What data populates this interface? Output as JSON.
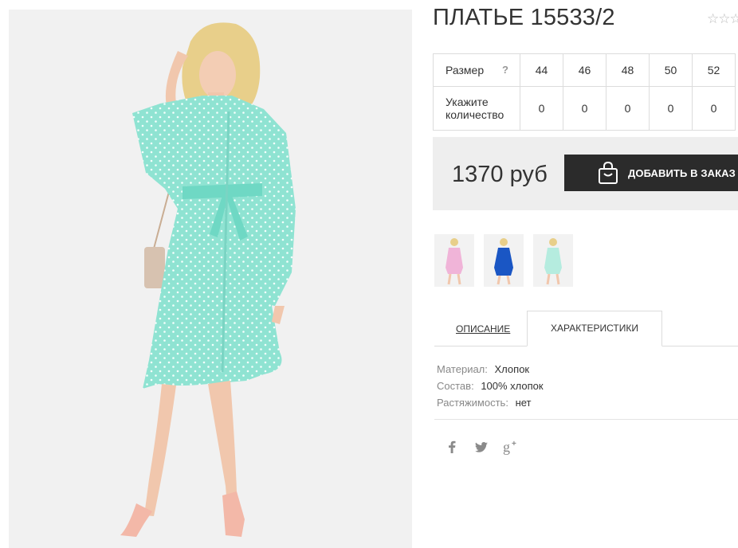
{
  "product": {
    "title": "ПЛАТЬЕ 15533/2",
    "rating_stars": "☆☆☆☆☆",
    "main_image": "model-mint-polka-dot-shirt-dress"
  },
  "sizes": {
    "size_label": "Размер",
    "help_label": "?",
    "values": [
      "44",
      "46",
      "48",
      "50",
      "52"
    ],
    "qty_label": "Укажите количество",
    "quantities": [
      "0",
      "0",
      "0",
      "0",
      "0"
    ]
  },
  "price": {
    "text": "1370 руб",
    "add_button_label": "ДОБАВИТЬ В ЗАКАЗ",
    "button_icon": "shopping-bag-icon"
  },
  "thumbnails": [
    {
      "name": "pink-dress",
      "color": "#f0b4d8"
    },
    {
      "name": "blue-dress",
      "color": "#1a56c4"
    },
    {
      "name": "mint-dress",
      "color": "#b5ecdf"
    }
  ],
  "tabs": {
    "description": "ОПИСАНИЕ",
    "characteristics": "ХАРАКТЕРИСТИКИ"
  },
  "specs": [
    {
      "key": "Материал:",
      "value": "Хлопок"
    },
    {
      "key": "Состав:",
      "value": "100% хлопок"
    },
    {
      "key": "Растяжимость:",
      "value": "нет"
    }
  ],
  "social": [
    "facebook-icon",
    "twitter-icon",
    "google-plus-icon"
  ],
  "colors": {
    "dark_button": "#2b2b2b",
    "panel_bg": "#eeeeee",
    "dress_mint": "#8fe3d2"
  }
}
